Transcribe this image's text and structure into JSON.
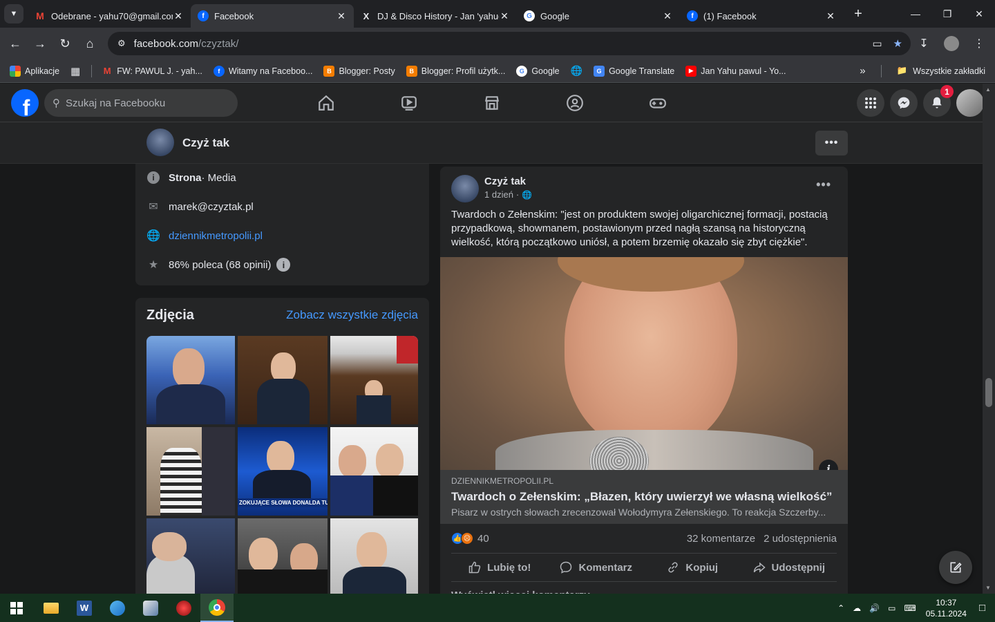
{
  "browser": {
    "tabs": [
      {
        "title": "Odebrane - yahu70@gmail.com",
        "icon": "gmail-icon"
      },
      {
        "title": "Facebook",
        "icon": "facebook-icon",
        "active": true
      },
      {
        "title": "DJ & Disco History - Jan 'yahudi",
        "icon": "x-icon"
      },
      {
        "title": "Google",
        "icon": "google-icon"
      },
      {
        "title": "(1) Facebook",
        "icon": "facebook-icon"
      }
    ],
    "url_domain": "facebook.com",
    "url_path": "/czyztak/",
    "bookmarks": [
      {
        "label": "Aplikacje",
        "icon": "apps-grid-icon"
      },
      {
        "label": "FW: PAWUL J. - yah...",
        "icon": "gmail-icon"
      },
      {
        "label": "Witamy na Faceboo...",
        "icon": "facebook-icon"
      },
      {
        "label": "Blogger: Posty",
        "icon": "blogger-icon"
      },
      {
        "label": "Blogger: Profil użytk...",
        "icon": "blogger-icon"
      },
      {
        "label": "Google",
        "icon": "google-icon"
      },
      {
        "label": "Google Translate",
        "icon": "translate-icon"
      },
      {
        "label": "Jan Yahu pawul - Yo...",
        "icon": "youtube-icon"
      }
    ],
    "all_bookmarks": "Wszystkie zakładki"
  },
  "facebook": {
    "search_placeholder": "Szukaj na Facebooku",
    "notification_count": "1",
    "page_name": "Czyż tak",
    "intro": {
      "category_bold": "Strona",
      "category_rest": " · Media",
      "email": "marek@czyztak.pl",
      "website": "dziennikmetropolii.pl",
      "rating": "86% poleca (68 opinii)"
    },
    "photos": {
      "heading": "Zdjęcia",
      "see_all": "Zobacz wszystkie zdjęcia",
      "caption_tile5": "ZOKUJĄCE SŁOWA DONALDA TU"
    },
    "post": {
      "author": "Czyż tak",
      "time": "1 dzień",
      "text": "Twardoch o Zełenskim: \"jest on produktem swojej oligarchicznej formacji, postacią przypadkową, showmanem, postawionym przed nagłą szansą na historyczną wielkość, którą początkowo uniósł, a potem brzemię okazało się zbyt ciężkie\".",
      "link_domain": "DZIENNIKMETROPOLII.PL",
      "link_title": "Twardoch o Zełenskim: „Błazen, który uwierzył we własną wielkość”",
      "link_desc": "Pisarz w ostrych słowach zrecenzował Wołodymyra Zełenskiego. To reakcja Szczerby...",
      "reaction_count": "40",
      "comments": "32 komentarze",
      "shares": "2 udostępnienia",
      "like": "Lubię to!",
      "comment": "Komentarz",
      "copy": "Kopiuj",
      "share": "Udostępnij",
      "more_comments": "Wyświetl więcej komentarzy"
    }
  },
  "taskbar": {
    "time": "10:37",
    "date": "05.11.2024"
  },
  "colors": {
    "fb_blue": "#0866ff",
    "link_blue": "#4599ff",
    "card_bg": "#242526",
    "page_bg": "#18191a",
    "notification_red": "#e41e3f"
  }
}
